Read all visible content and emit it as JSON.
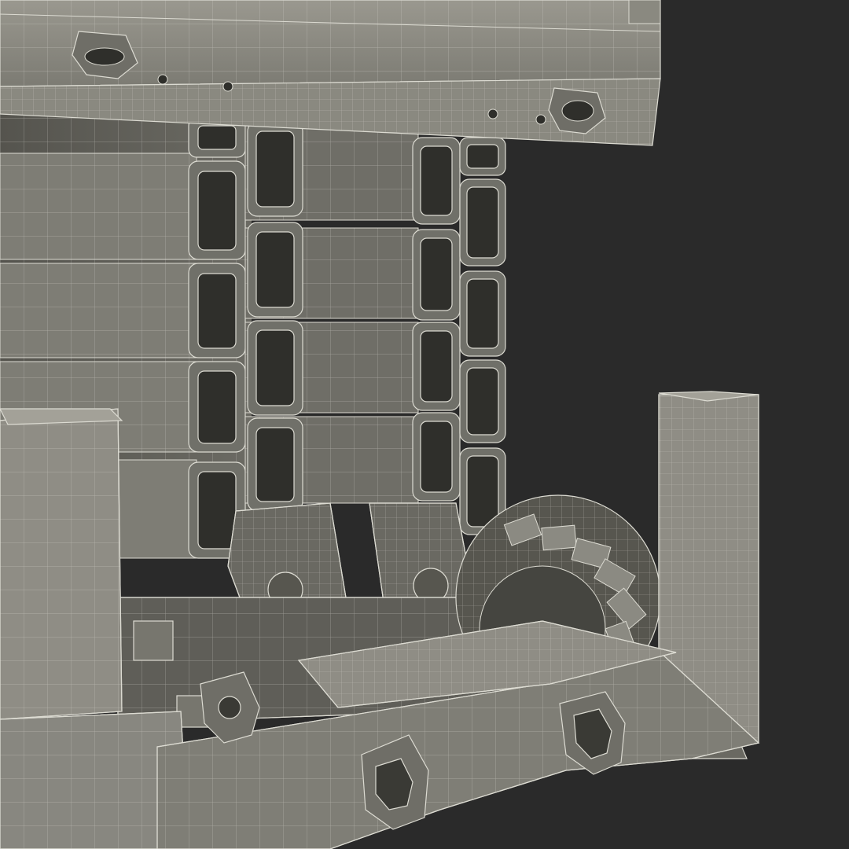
{
  "scene": {
    "subject": "scissor-lift-wireframe-render",
    "colors": {
      "background": "#2a2a2a",
      "metal_light": "#8d8b82",
      "metal_mid": "#74736b",
      "metal_dark": "#57564f",
      "cavity": "#2f2f2b",
      "wire": "#d9d8cf"
    }
  }
}
